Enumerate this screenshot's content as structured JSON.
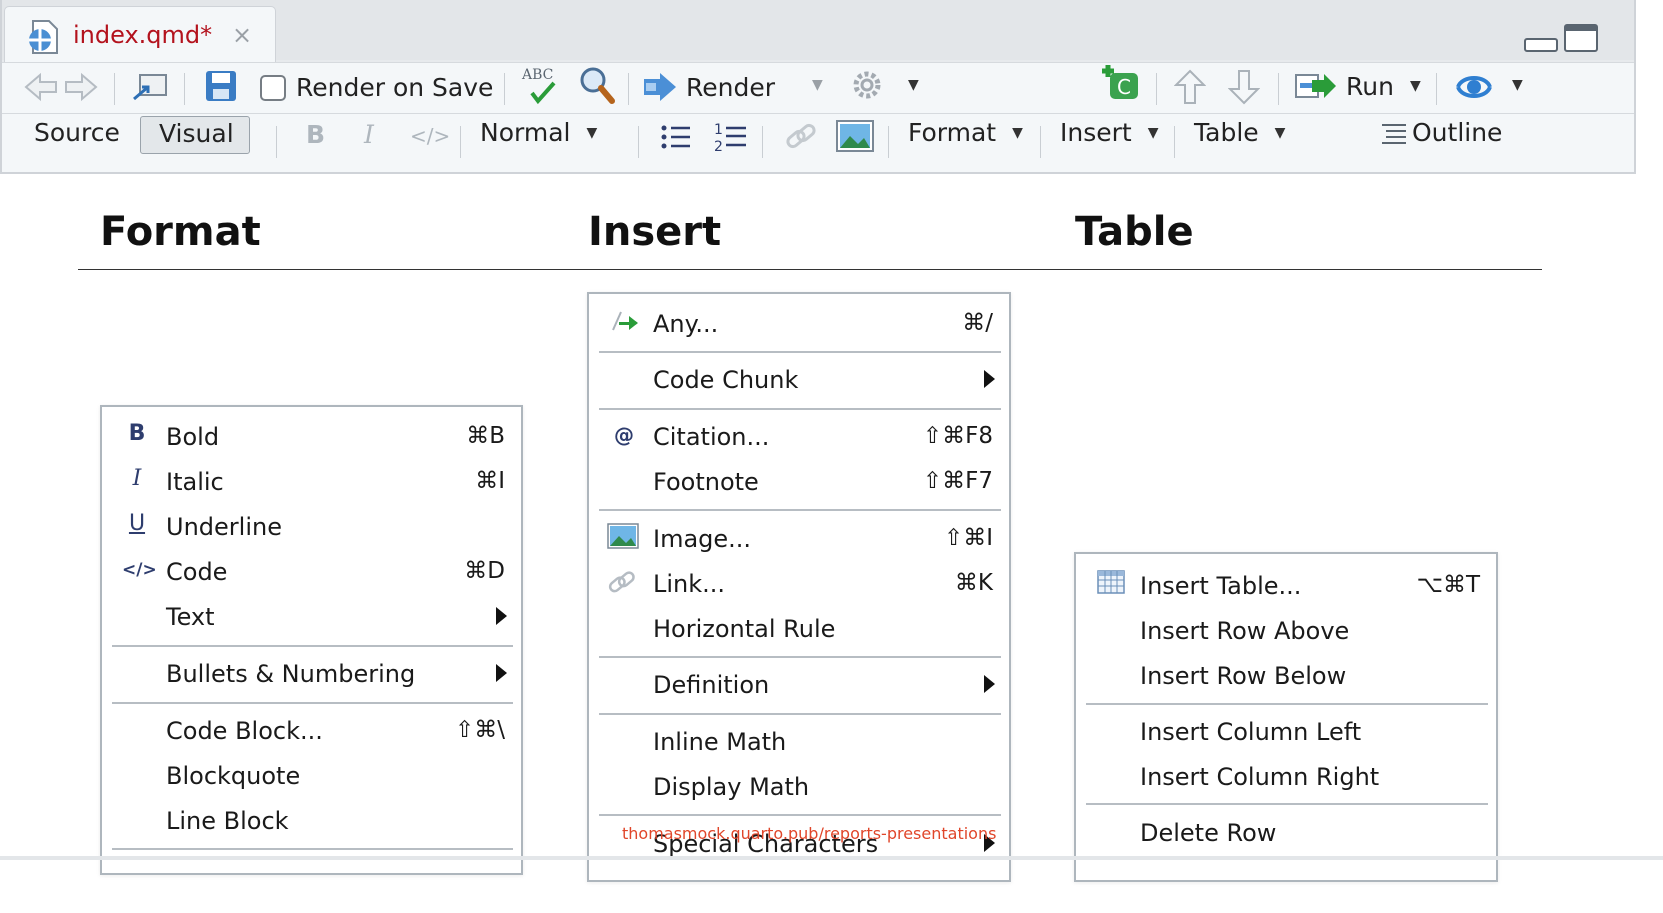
{
  "editor": {
    "tab_title": "index.qmd*",
    "close_glyph": "×",
    "toolbar": {
      "render_on_save": "Render on Save",
      "render": "Render",
      "run": "Run",
      "spell_label": "ABC"
    },
    "visual_toolbar": {
      "source": "Source",
      "visual": "Visual",
      "bold_glyph": "B",
      "italic_glyph": "I",
      "code_glyph": "</>",
      "style": "Normal",
      "format": "Format",
      "insert": "Insert",
      "table": "Table",
      "outline": "Outline"
    }
  },
  "headings": {
    "format": "Format",
    "insert": "Insert",
    "table": "Table"
  },
  "format_menu": {
    "items": [
      {
        "icon": "B",
        "label": "Bold",
        "shortcut": "⌘B"
      },
      {
        "icon": "I",
        "label": "Italic",
        "shortcut": "⌘I"
      },
      {
        "icon": "U",
        "label": "Underline",
        "shortcut": ""
      },
      {
        "icon": "</>",
        "label": "Code",
        "shortcut": "⌘D"
      },
      {
        "icon": "",
        "label": "Text",
        "shortcut": ""
      },
      {
        "icon": "",
        "label": "Bullets & Numbering",
        "shortcut": ""
      },
      {
        "icon": "",
        "label": "Code Block...",
        "shortcut": "⇧⌘\\"
      },
      {
        "icon": "",
        "label": "Blockquote",
        "shortcut": ""
      },
      {
        "icon": "",
        "label": "Line Block",
        "shortcut": ""
      }
    ]
  },
  "insert_menu": {
    "items": [
      {
        "icon": "",
        "label": "Any...",
        "shortcut": "⌘/"
      },
      {
        "icon": "",
        "label": "Code Chunk",
        "shortcut": ""
      },
      {
        "icon": "@",
        "label": "Citation...",
        "shortcut": "⇧⌘F8"
      },
      {
        "icon": "",
        "label": "Footnote",
        "shortcut": "⇧⌘F7"
      },
      {
        "icon": "",
        "label": "Image...",
        "shortcut": "⇧⌘I"
      },
      {
        "icon": "",
        "label": "Link...",
        "shortcut": "⌘K"
      },
      {
        "icon": "",
        "label": "Horizontal Rule",
        "shortcut": ""
      },
      {
        "icon": "",
        "label": "Definition",
        "shortcut": ""
      },
      {
        "icon": "",
        "label": "Inline Math",
        "shortcut": ""
      },
      {
        "icon": "",
        "label": "Display Math",
        "shortcut": ""
      },
      {
        "icon": "",
        "label": "Special Characters",
        "shortcut": ""
      }
    ]
  },
  "table_menu": {
    "items": [
      {
        "icon": "",
        "label": "Insert Table...",
        "shortcut": "⌥⌘T"
      },
      {
        "icon": "",
        "label": "Insert Row Above",
        "shortcut": ""
      },
      {
        "icon": "",
        "label": "Insert Row Below",
        "shortcut": ""
      },
      {
        "icon": "",
        "label": "Insert Column Left",
        "shortcut": ""
      },
      {
        "icon": "",
        "label": "Insert Column Right",
        "shortcut": ""
      },
      {
        "icon": "",
        "label": "Delete Row",
        "shortcut": ""
      }
    ]
  },
  "watermark": "thomasmock.quarto.pub/reports-presentations"
}
